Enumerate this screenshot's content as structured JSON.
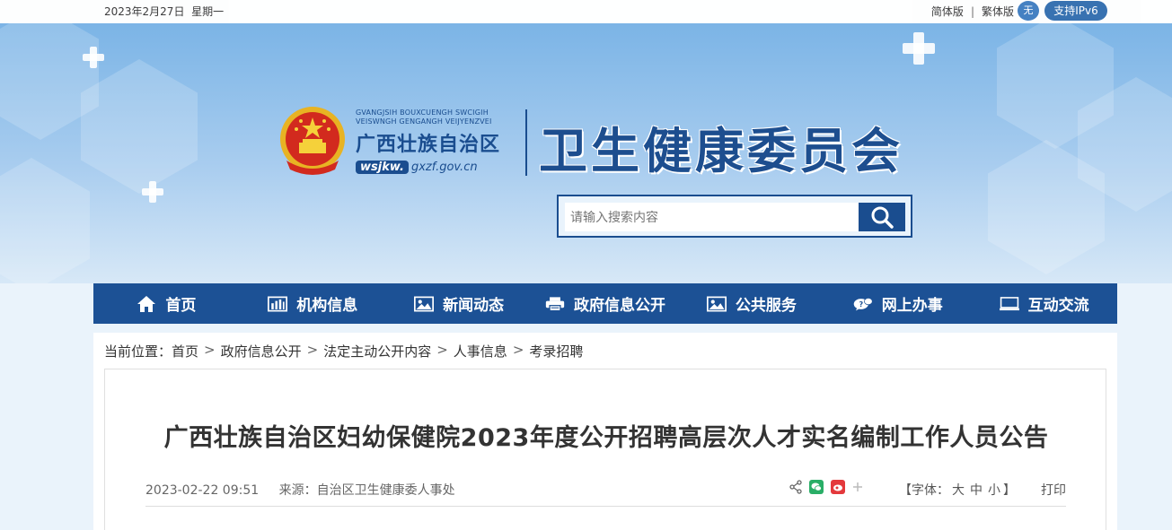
{
  "topbar": {
    "date": "2023年2月27日",
    "weekday": "星期一",
    "simplified": "简体版",
    "traditional": "繁体版",
    "accessibility_label": "无",
    "ipv6": "支持IPv6"
  },
  "header": {
    "pinyin_line1": "GVANGJSIH BOUXCUENGH SWCIGIH",
    "pinyin_line2": "VEISWNGH GENGANGH VEIJYENZVEI",
    "region_name": "广西壮族自治区",
    "url_prefix": "wsjkw.",
    "url_domain": "gxzf.gov.cn",
    "site_title": "卫生健康委员会"
  },
  "search": {
    "placeholder": "请输入搜索内容"
  },
  "nav": {
    "items": [
      {
        "label": "首页",
        "icon": "home-icon"
      },
      {
        "label": "机构信息",
        "icon": "bar-chart-icon"
      },
      {
        "label": "新闻动态",
        "icon": "picture-icon"
      },
      {
        "label": "政府信息公开",
        "icon": "printer-icon"
      },
      {
        "label": "公共服务",
        "icon": "picture-icon"
      },
      {
        "label": "网上办事",
        "icon": "chat-icon"
      },
      {
        "label": "互动交流",
        "icon": "monitor-icon"
      }
    ]
  },
  "breadcrumb": {
    "prefix": "当前位置：",
    "items": [
      "首页",
      "政府信息公开",
      "法定主动公开内容",
      "人事信息",
      "考录招聘"
    ]
  },
  "article": {
    "title": "广西壮族自治区妇幼保健院2023年度公开招聘高层次人才实名编制工作人员公告",
    "datetime": "2023-02-22 09:51",
    "source_label": "来源：",
    "source_value": "自治区卫生健康委人事处",
    "font_label_open": "【字体：",
    "font_large": "大",
    "font_medium": "中",
    "font_small": "小",
    "font_label_close": "】",
    "print": "打印"
  },
  "colors": {
    "primary": "#1c5195",
    "banner_top": "#7bb4e6",
    "banner_bottom": "#d7e8f7"
  }
}
